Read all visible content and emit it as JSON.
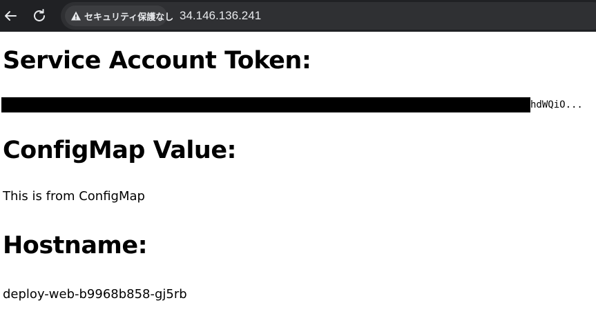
{
  "browser": {
    "security_label": "セキュリティ保護なし",
    "url": "34.146.136.241"
  },
  "page": {
    "token_heading": "Service Account Token:",
    "token_visible_tail": "hdWQiO...",
    "configmap_heading": "ConfigMap Value:",
    "configmap_value": "This is from ConfigMap",
    "hostname_heading": "Hostname:",
    "hostname_value": "deploy-web-b9968b858-gj5rb"
  }
}
